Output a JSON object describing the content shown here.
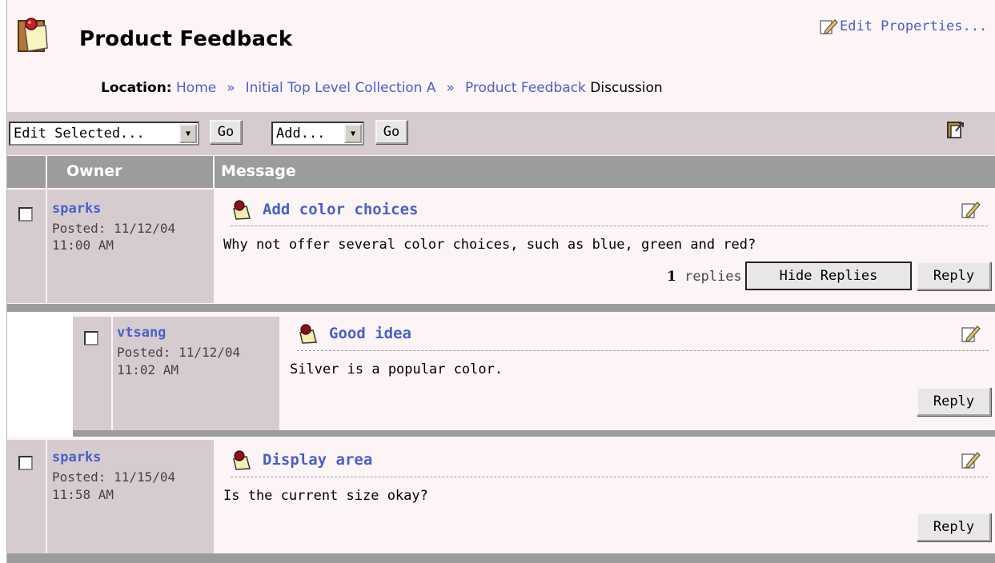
{
  "header": {
    "title": "Product Feedback",
    "edit_properties": "Edit Properties..."
  },
  "location": {
    "label": "Location:",
    "crumbs": [
      "Home",
      "Initial Top Level Collection A",
      "Product Feedback"
    ],
    "separator": "»",
    "suffix": "Discussion"
  },
  "toolbar": {
    "edit_select": "Edit Selected...",
    "go1": "Go",
    "add_select": "Add...",
    "go2": "Go"
  },
  "table": {
    "columns": [
      "Owner",
      "Message"
    ]
  },
  "posts": [
    {
      "owner": "sparks",
      "posted_line1": "Posted: 11/12/04",
      "posted_line2": "11:00 AM",
      "subject": "Add color choices",
      "body": "Why not offer several color choices, such as blue, green and red?",
      "replies_count": "1",
      "replies_label": "replies",
      "hide_replies": "Hide Replies",
      "reply": "Reply"
    },
    {
      "owner": "vtsang",
      "posted_line1": "Posted: 11/12/04",
      "posted_line2": "11:02 AM",
      "subject": "Good idea",
      "body": "Silver is a popular color.",
      "reply": "Reply"
    },
    {
      "owner": "sparks",
      "posted_line1": "Posted: 11/15/04",
      "posted_line2": "11:58 AM",
      "subject": "Display area",
      "body": "Is the current size okay?",
      "reply": "Reply"
    }
  ],
  "colors": {
    "link": "#4860c8",
    "panel": "#fdf4f6",
    "owner_cell": "#d6cccf",
    "header_bar": "#9c9c9c"
  },
  "icons": {
    "app": "discussion-pin-icon",
    "edit": "pencil-edit-icon",
    "post": "pushpin-note-icon",
    "toolbar": "export-icon"
  }
}
